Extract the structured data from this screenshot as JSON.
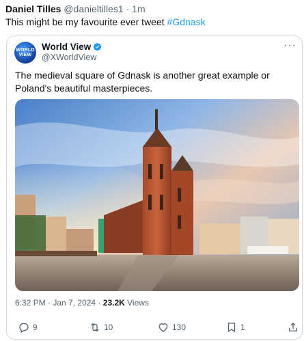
{
  "outer": {
    "name": "Daniel Tilles",
    "handle": "@danieltilles1",
    "sep": " · ",
    "time": "1m",
    "text": "This might be my favourite ever tweet ",
    "hashtag": "#Gdnask"
  },
  "quoted": {
    "avatar_line1": "WORLD",
    "avatar_line2": "VIEW",
    "name": "World View",
    "handle": "@XWorldView",
    "more": "···",
    "text": "The medieval square of Gdnask is another great example or Poland's beautiful masterpieces.",
    "image_icon": "photo-of-medieval-square",
    "time": "6:32 PM",
    "date": "Jan 7, 2024",
    "views_count": "23.2K",
    "views_label": "Views",
    "sep": " · "
  },
  "actions": {
    "replies": "9",
    "reposts": "10",
    "likes": "130",
    "bookmarks": "1"
  },
  "colors": {
    "accent": "#1d9bf0",
    "muted": "#536471",
    "border": "#cfd9de"
  }
}
